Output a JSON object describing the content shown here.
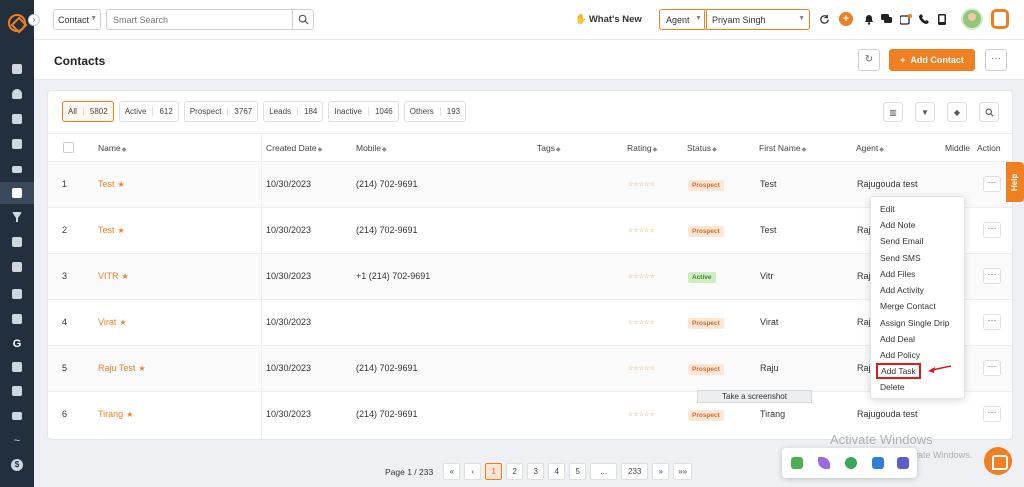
{
  "topbar": {
    "type_select": "Contact",
    "search_placeholder": "Smart Search",
    "whats_new": "What's New",
    "agent_select": "Agent",
    "user_select": "Priyam Singh"
  },
  "header": {
    "title": "Contacts",
    "add_contact": "Add Contact"
  },
  "filters": [
    {
      "label": "All",
      "count": "5802"
    },
    {
      "label": "Active",
      "count": "612"
    },
    {
      "label": "Prospect",
      "count": "3767"
    },
    {
      "label": "Leads",
      "count": "184"
    },
    {
      "label": "Inactive",
      "count": "1046"
    },
    {
      "label": "Others",
      "count": "193"
    }
  ],
  "columns": {
    "name": "Name",
    "created": "Created Date",
    "mobile": "Mobile",
    "tags": "Tags",
    "rating": "Rating",
    "status": "Status",
    "first_name": "First Name",
    "agent": "Agent",
    "middle": "Middle",
    "action": "Action"
  },
  "rows": [
    {
      "idx": "1",
      "name": "Test",
      "created": "10/30/2023",
      "mobile": "(214) 702-9691",
      "rating": "☆☆☆☆☆",
      "status": "Prospect",
      "first_name": "Test",
      "agent": "Rajugouda test"
    },
    {
      "idx": "2",
      "name": "Test",
      "created": "10/30/2023",
      "mobile": "(214) 702-9691",
      "rating": "☆☆☆☆☆",
      "status": "Prospect",
      "first_name": "Test",
      "agent": "Raj"
    },
    {
      "idx": "3",
      "name": "VITR",
      "created": "10/30/2023",
      "mobile": "+1 (214) 702-9691",
      "rating": "☆☆☆☆☆",
      "status": "Active",
      "first_name": "Vitr",
      "agent": "Raj"
    },
    {
      "idx": "4",
      "name": "Virat",
      "created": "10/30/2023",
      "mobile": "",
      "rating": "☆☆☆☆☆",
      "status": "Prospect",
      "first_name": "Virat",
      "agent": "Raj"
    },
    {
      "idx": "5",
      "name": "Raju Test",
      "created": "10/30/2023",
      "mobile": "(214) 702-9691",
      "rating": "☆☆☆☆☆",
      "status": "Prospect",
      "first_name": "Raju",
      "agent": "Raj"
    },
    {
      "idx": "6",
      "name": "Tirang",
      "created": "10/30/2023",
      "mobile": "(214) 702-9691",
      "rating": "☆☆☆☆☆",
      "status": "Prospect",
      "first_name": "Tirang",
      "agent": "Rajugouda test"
    }
  ],
  "menu": {
    "edit": "Edit",
    "add_note": "Add Note",
    "send_email": "Send Email",
    "send_sms": "Send SMS",
    "add_files": "Add Files",
    "add_activity": "Add Activity",
    "merge_contact": "Merge Contact",
    "assign_drip": "Assign Single Drip",
    "add_deal": "Add Deal",
    "add_policy": "Add Policy",
    "add_task": "Add Task",
    "delete": "Delete"
  },
  "screenshot_tip": "Take a screenshot",
  "help": "Help",
  "pagination": {
    "info": "Page 1 / 233",
    "first": "«",
    "prev": "‹",
    "p1": "1",
    "p2": "2",
    "p3": "3",
    "p4": "4",
    "p5": "5",
    "ellipsis": "...",
    "last_page": "233",
    "next": "»",
    "last": "»»"
  },
  "watermark": {
    "line1": "Activate Windows",
    "line2": "Go to Settings to activate Windows."
  },
  "colors": {
    "accent": "#f07f22",
    "sidebar": "#22303e",
    "prospect_bg": "#fde6d6",
    "active_bg": "#cfecc4",
    "highlight": "#e01b1b"
  }
}
